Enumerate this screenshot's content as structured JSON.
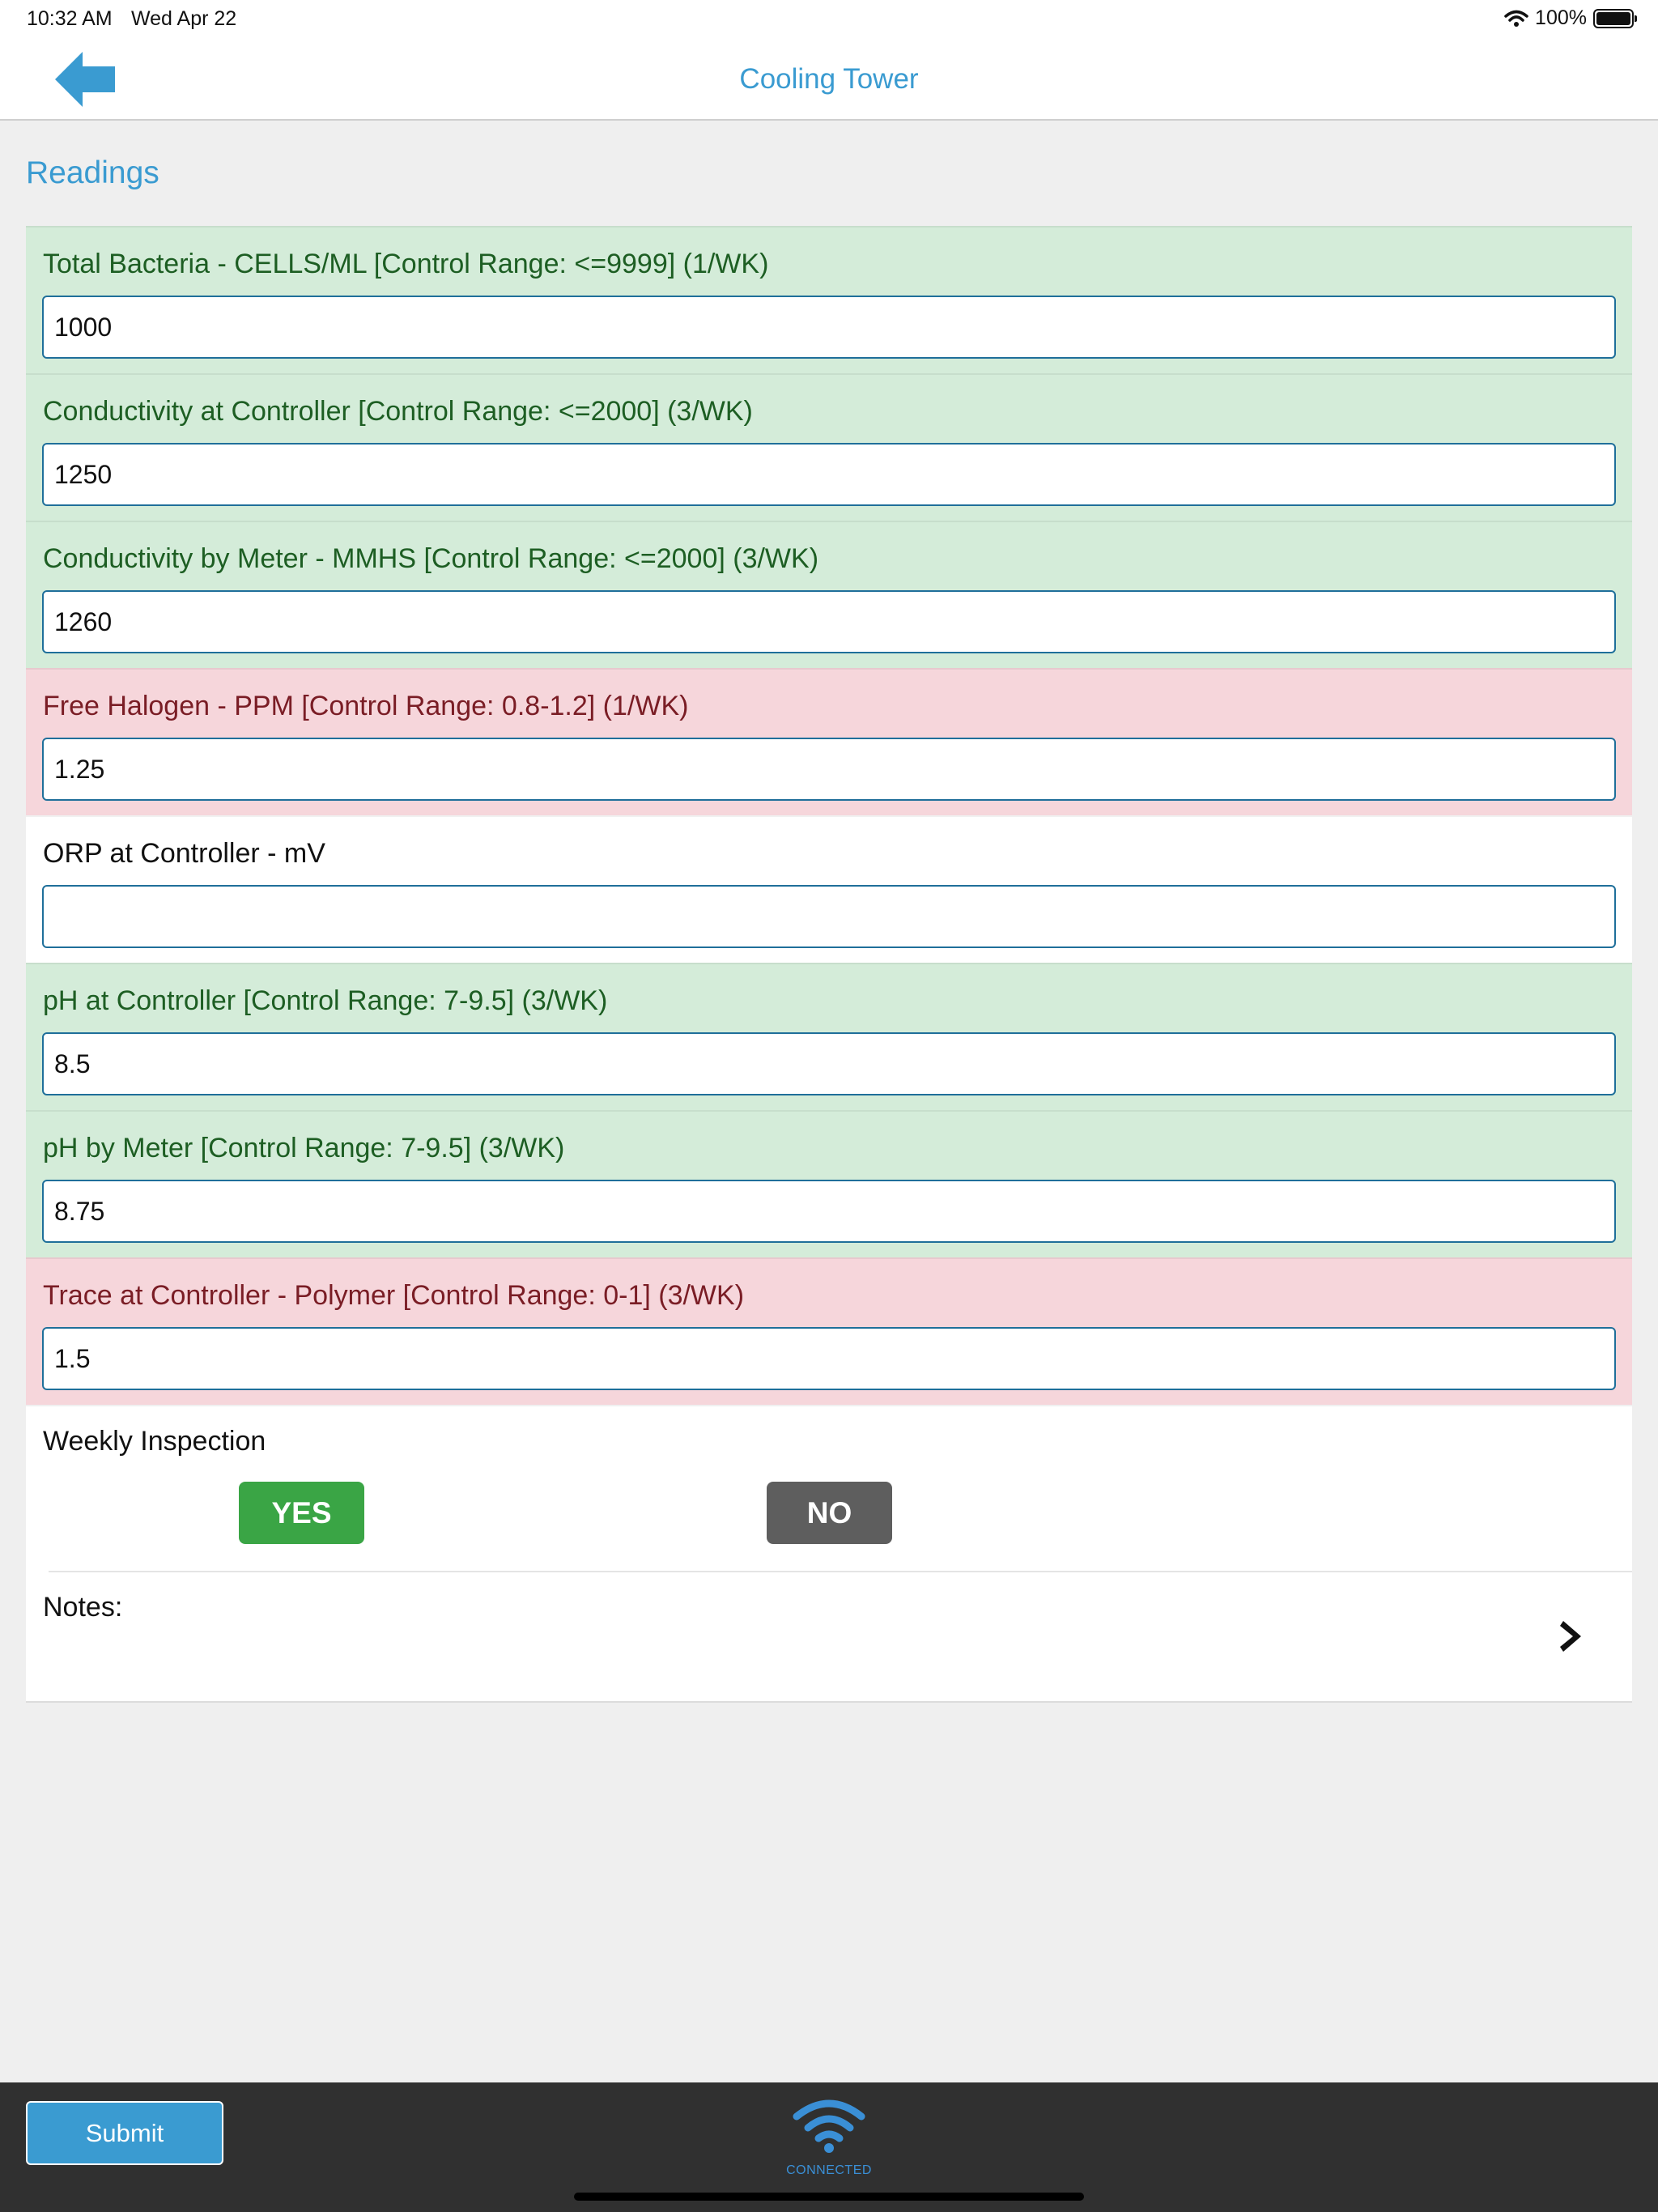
{
  "status_bar": {
    "time": "10:32 AM",
    "date": "Wed Apr 22",
    "battery": "100%"
  },
  "nav": {
    "title": "Cooling Tower"
  },
  "section": {
    "title": "Readings"
  },
  "fields": [
    {
      "label": "Total Bacteria - CELLS/ML [Control Range: <=9999] (1/WK)",
      "value": "1000",
      "status": "ok"
    },
    {
      "label": "Conductivity at Controller [Control Range: <=2000] (3/WK)",
      "value": "1250",
      "status": "ok"
    },
    {
      "label": "Conductivity by Meter - MMHS [Control Range: <=2000] (3/WK)",
      "value": "1260",
      "status": "ok"
    },
    {
      "label": "Free Halogen - PPM [Control Range: 0.8-1.2] (1/WK)",
      "value": "1.25",
      "status": "bad"
    },
    {
      "label": "ORP at Controller - mV",
      "value": "",
      "status": "neutral"
    },
    {
      "label": "pH at Controller [Control Range: 7-9.5] (3/WK)",
      "value": "8.5",
      "status": "ok"
    },
    {
      "label": "pH by Meter [Control Range: 7-9.5] (3/WK)",
      "value": "8.75",
      "status": "ok"
    },
    {
      "label": "Trace at Controller - Polymer [Control Range: 0-1] (3/WK)",
      "value": "1.5",
      "status": "bad"
    }
  ],
  "inspection": {
    "label": "Weekly Inspection",
    "yes_label": "YES",
    "no_label": "NO"
  },
  "notes": {
    "label": "Notes:"
  },
  "toolbar": {
    "submit_label": "Submit",
    "connection_label": "CONNECTED"
  },
  "colors": {
    "accent": "#3a9bd1",
    "ok_bg": "#d4ecd9",
    "bad_bg": "#f6d6db",
    "yes": "#3aa545",
    "no": "#5e5e5e"
  }
}
